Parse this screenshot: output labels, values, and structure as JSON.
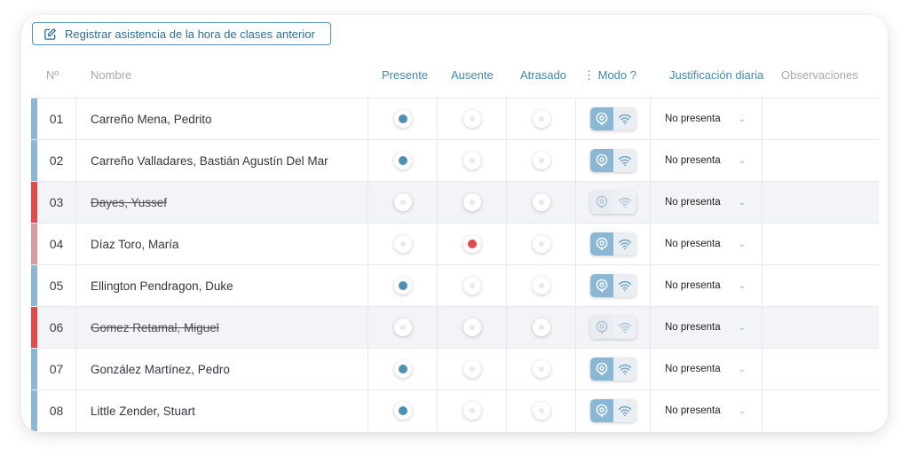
{
  "register_button": {
    "label": "Registrar asistencia de la hora de clases anterior"
  },
  "headers": {
    "num": "Nº",
    "name": "Nombre",
    "present": "Presente",
    "absent": "Ausente",
    "late": "Atrasado",
    "mode": "⋮ Modo ?",
    "justification": "Justificación diaria",
    "observations": "Observaciones"
  },
  "colors": {
    "accent": "#3d89b6",
    "present_dot": "#4e8fb6",
    "absent_dot": "#e4484a",
    "bar_blue": "#8ab8d4",
    "bar_red": "#e4484a",
    "bar_pink": "#d99a9c"
  },
  "students": [
    {
      "num": "01",
      "name": "Carreño Mena, Pedrito",
      "status": "present",
      "bar": "blue",
      "withdrawn": false,
      "justification": "No presenta"
    },
    {
      "num": "02",
      "name": "Carreño Valladares, Bastián Agustín Del Mar",
      "status": "present",
      "bar": "blue",
      "withdrawn": false,
      "justification": "No presenta"
    },
    {
      "num": "03",
      "name": "Dayes, Yussef",
      "status": "none",
      "bar": "red",
      "withdrawn": true,
      "justification": "No presenta"
    },
    {
      "num": "04",
      "name": "Díaz Toro, María",
      "status": "absent",
      "bar": "pink",
      "withdrawn": false,
      "justification": "No presenta"
    },
    {
      "num": "05",
      "name": "Ellington Pendragon, Duke",
      "status": "present",
      "bar": "blue",
      "withdrawn": false,
      "justification": "No presenta"
    },
    {
      "num": "06",
      "name": "Gomez Retamal, Miguel",
      "status": "none",
      "bar": "red",
      "withdrawn": true,
      "justification": "No presenta"
    },
    {
      "num": "07",
      "name": "González Martínez, Pedro",
      "status": "present",
      "bar": "blue",
      "withdrawn": false,
      "justification": "No presenta"
    },
    {
      "num": "08",
      "name": "Little Zender, Stuart",
      "status": "present",
      "bar": "blue",
      "withdrawn": false,
      "justification": "No presenta"
    }
  ]
}
